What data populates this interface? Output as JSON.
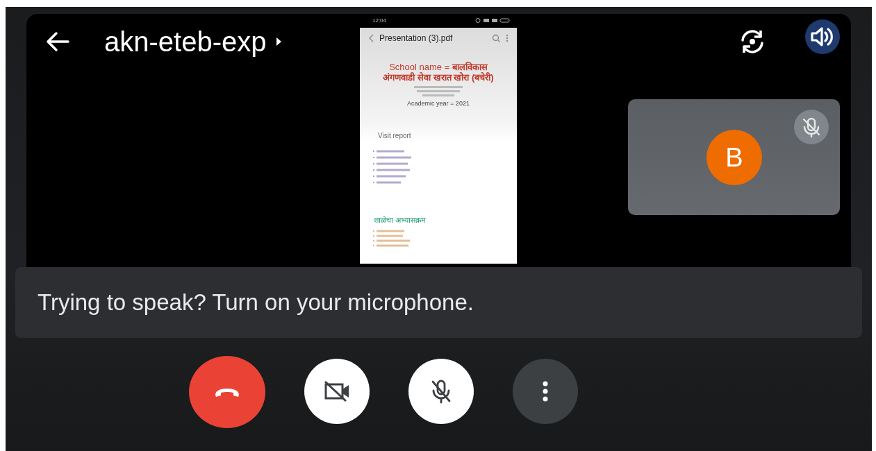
{
  "call": {
    "title": "akn-eteb-exp"
  },
  "shared_screen": {
    "status_time": "12:04",
    "file_title": "Presentation (3).pdf",
    "heading": "School name  = **बालविकास अंगणवाडी सेवा खरात खोरा (बचेरी)**",
    "detail": "Academic year = 2021",
    "section_title": "Visit report",
    "section2_title": "शाळेचा अभ्यासक्रम"
  },
  "participant": {
    "initial": "B",
    "muted": true
  },
  "toast": {
    "text": "Trying to speak? Turn on your microphone."
  },
  "controls": [
    {
      "kind": "hangup"
    },
    {
      "kind": "camera",
      "on": false
    },
    {
      "kind": "mic",
      "on": false
    },
    {
      "kind": "more"
    }
  ]
}
